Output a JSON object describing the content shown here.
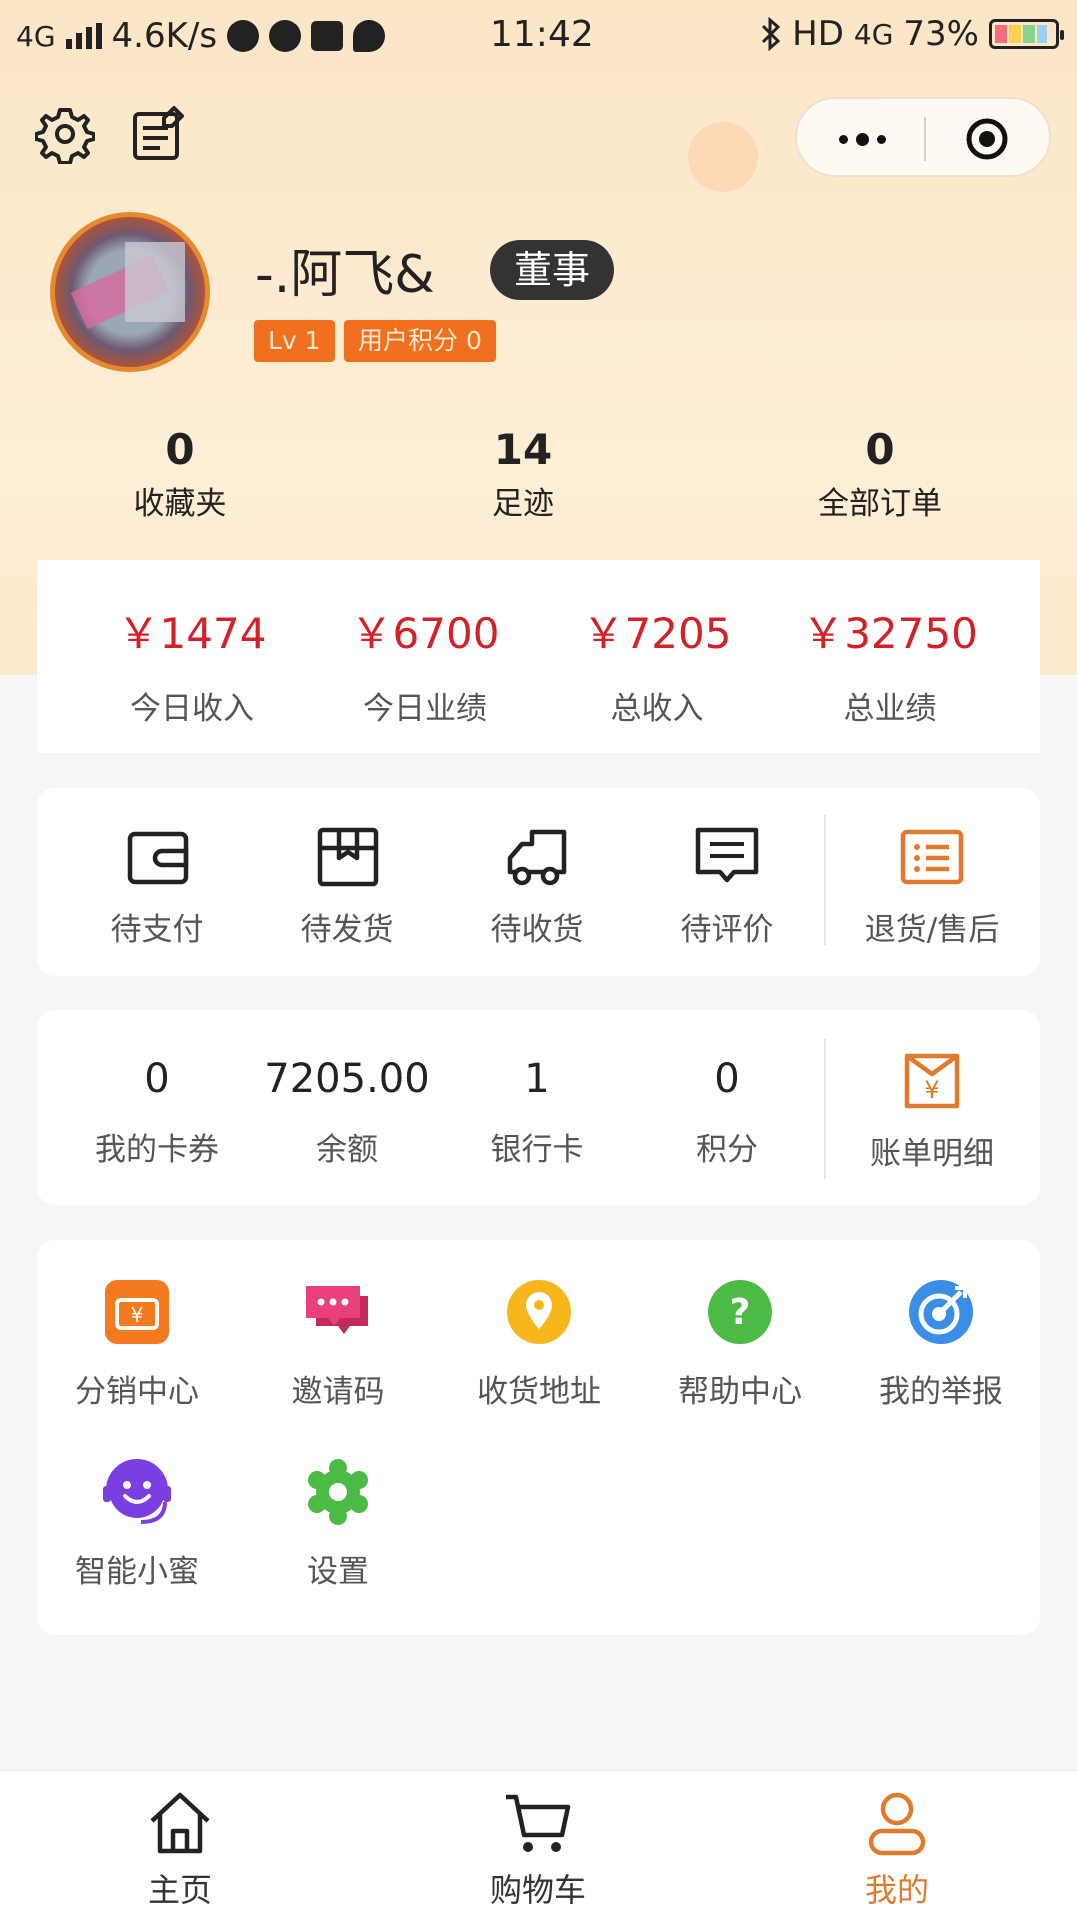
{
  "status_bar": {
    "network": "4G",
    "speed": "4.6K/s",
    "time": "11:42",
    "hd": "HD",
    "network_right": "4G",
    "battery": "73%"
  },
  "profile": {
    "name": "-.阿飞&",
    "role": "董事",
    "level": "Lv 1",
    "points_tag": "用户积分 0"
  },
  "stats": [
    {
      "value": "0",
      "label": "收藏夹"
    },
    {
      "value": "14",
      "label": "足迹"
    },
    {
      "value": "0",
      "label": "全部订单"
    }
  ],
  "income": [
    {
      "value": "￥1474",
      "label": "今日收入"
    },
    {
      "value": "￥6700",
      "label": "今日业绩"
    },
    {
      "value": "￥7205",
      "label": "总收入"
    },
    {
      "value": "￥32750",
      "label": "总业绩"
    }
  ],
  "orders": [
    {
      "label": "待支付",
      "icon": "wallet-icon"
    },
    {
      "label": "待发货",
      "icon": "package-icon"
    },
    {
      "label": "待收货",
      "icon": "truck-icon"
    },
    {
      "label": "待评价",
      "icon": "comment-icon"
    },
    {
      "label": "退货/售后",
      "icon": "list-icon"
    }
  ],
  "wallet": [
    {
      "value": "0",
      "label": "我的卡券"
    },
    {
      "value": "7205.00",
      "label": "余额"
    },
    {
      "value": "1",
      "label": "银行卡"
    },
    {
      "value": "0",
      "label": "积分"
    }
  ],
  "bill_label": "账单明细",
  "services": [
    {
      "label": "分销中心",
      "icon": "distribution-icon",
      "color": "#f47a1f"
    },
    {
      "label": "邀请码",
      "icon": "invite-icon",
      "color": "#ea3f7a"
    },
    {
      "label": "收货地址",
      "icon": "location-icon",
      "color": "#f7b61b"
    },
    {
      "label": "帮助中心",
      "icon": "help-icon",
      "color": "#4cbb45"
    },
    {
      "label": "我的举报",
      "icon": "report-icon",
      "color": "#3a8ee6"
    },
    {
      "label": "智能小蜜",
      "icon": "assistant-icon",
      "color": "#7a3fe0"
    },
    {
      "label": "设置",
      "icon": "settings-icon",
      "color": "#4cbb45"
    }
  ],
  "nav": [
    {
      "label": "主页",
      "icon": "home-icon"
    },
    {
      "label": "购物车",
      "icon": "cart-icon"
    },
    {
      "label": "我的",
      "icon": "user-icon"
    }
  ],
  "colors": {
    "accent": "#e07a2c",
    "money": "#d3212a",
    "tag": "#f07020"
  }
}
